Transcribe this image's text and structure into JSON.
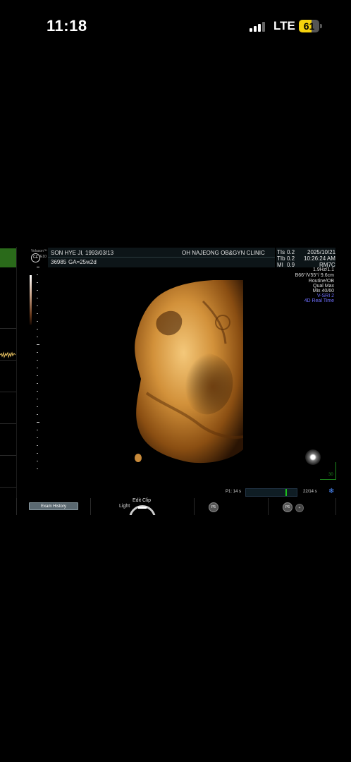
{
  "status_bar": {
    "time": "11:18",
    "network": "LTE",
    "battery_level": "61",
    "battery_fraction": 0.61,
    "battery_color": "#f5d20d"
  },
  "ultrasound": {
    "brand": "Voluson™",
    "logo": "ge-logo",
    "model": "E10",
    "header": {
      "patient_name": "SON HYE JI,",
      "birth_date": "1993/03/13",
      "patient_id": "36985",
      "gestational_age": "GA=25w2d",
      "clinic": "OH NAJEONG OB&GYN CLINIC"
    },
    "params": {
      "tis_label": "TIs",
      "tis_value": "0.2",
      "tib_label": "TIb",
      "tib_value": "0.2",
      "mi_label": "MI",
      "mi_value": "0.9",
      "date": "2025/10/21",
      "time": "10:26:24 AM",
      "probe": "RM7C"
    },
    "settings": [
      "1.9Hz/1.1",
      "B66°/V55°/ 9.6cm",
      "Routine/OB",
      "Qual Max",
      "Mix 40/60"
    ],
    "modes": [
      "V-SRI 2",
      "4D Real Time"
    ],
    "accent_color": "#6f6fff",
    "cine": {
      "label": "P1:  14 s",
      "frames": "22/14 s",
      "position": 0.8
    },
    "corner_number": "30",
    "bottom": {
      "exam_history": "Exam History",
      "edit_clip": "Edit Clip",
      "light": "Light",
      "p5": "P5",
      "p6": "P6",
      "small": "+"
    }
  }
}
